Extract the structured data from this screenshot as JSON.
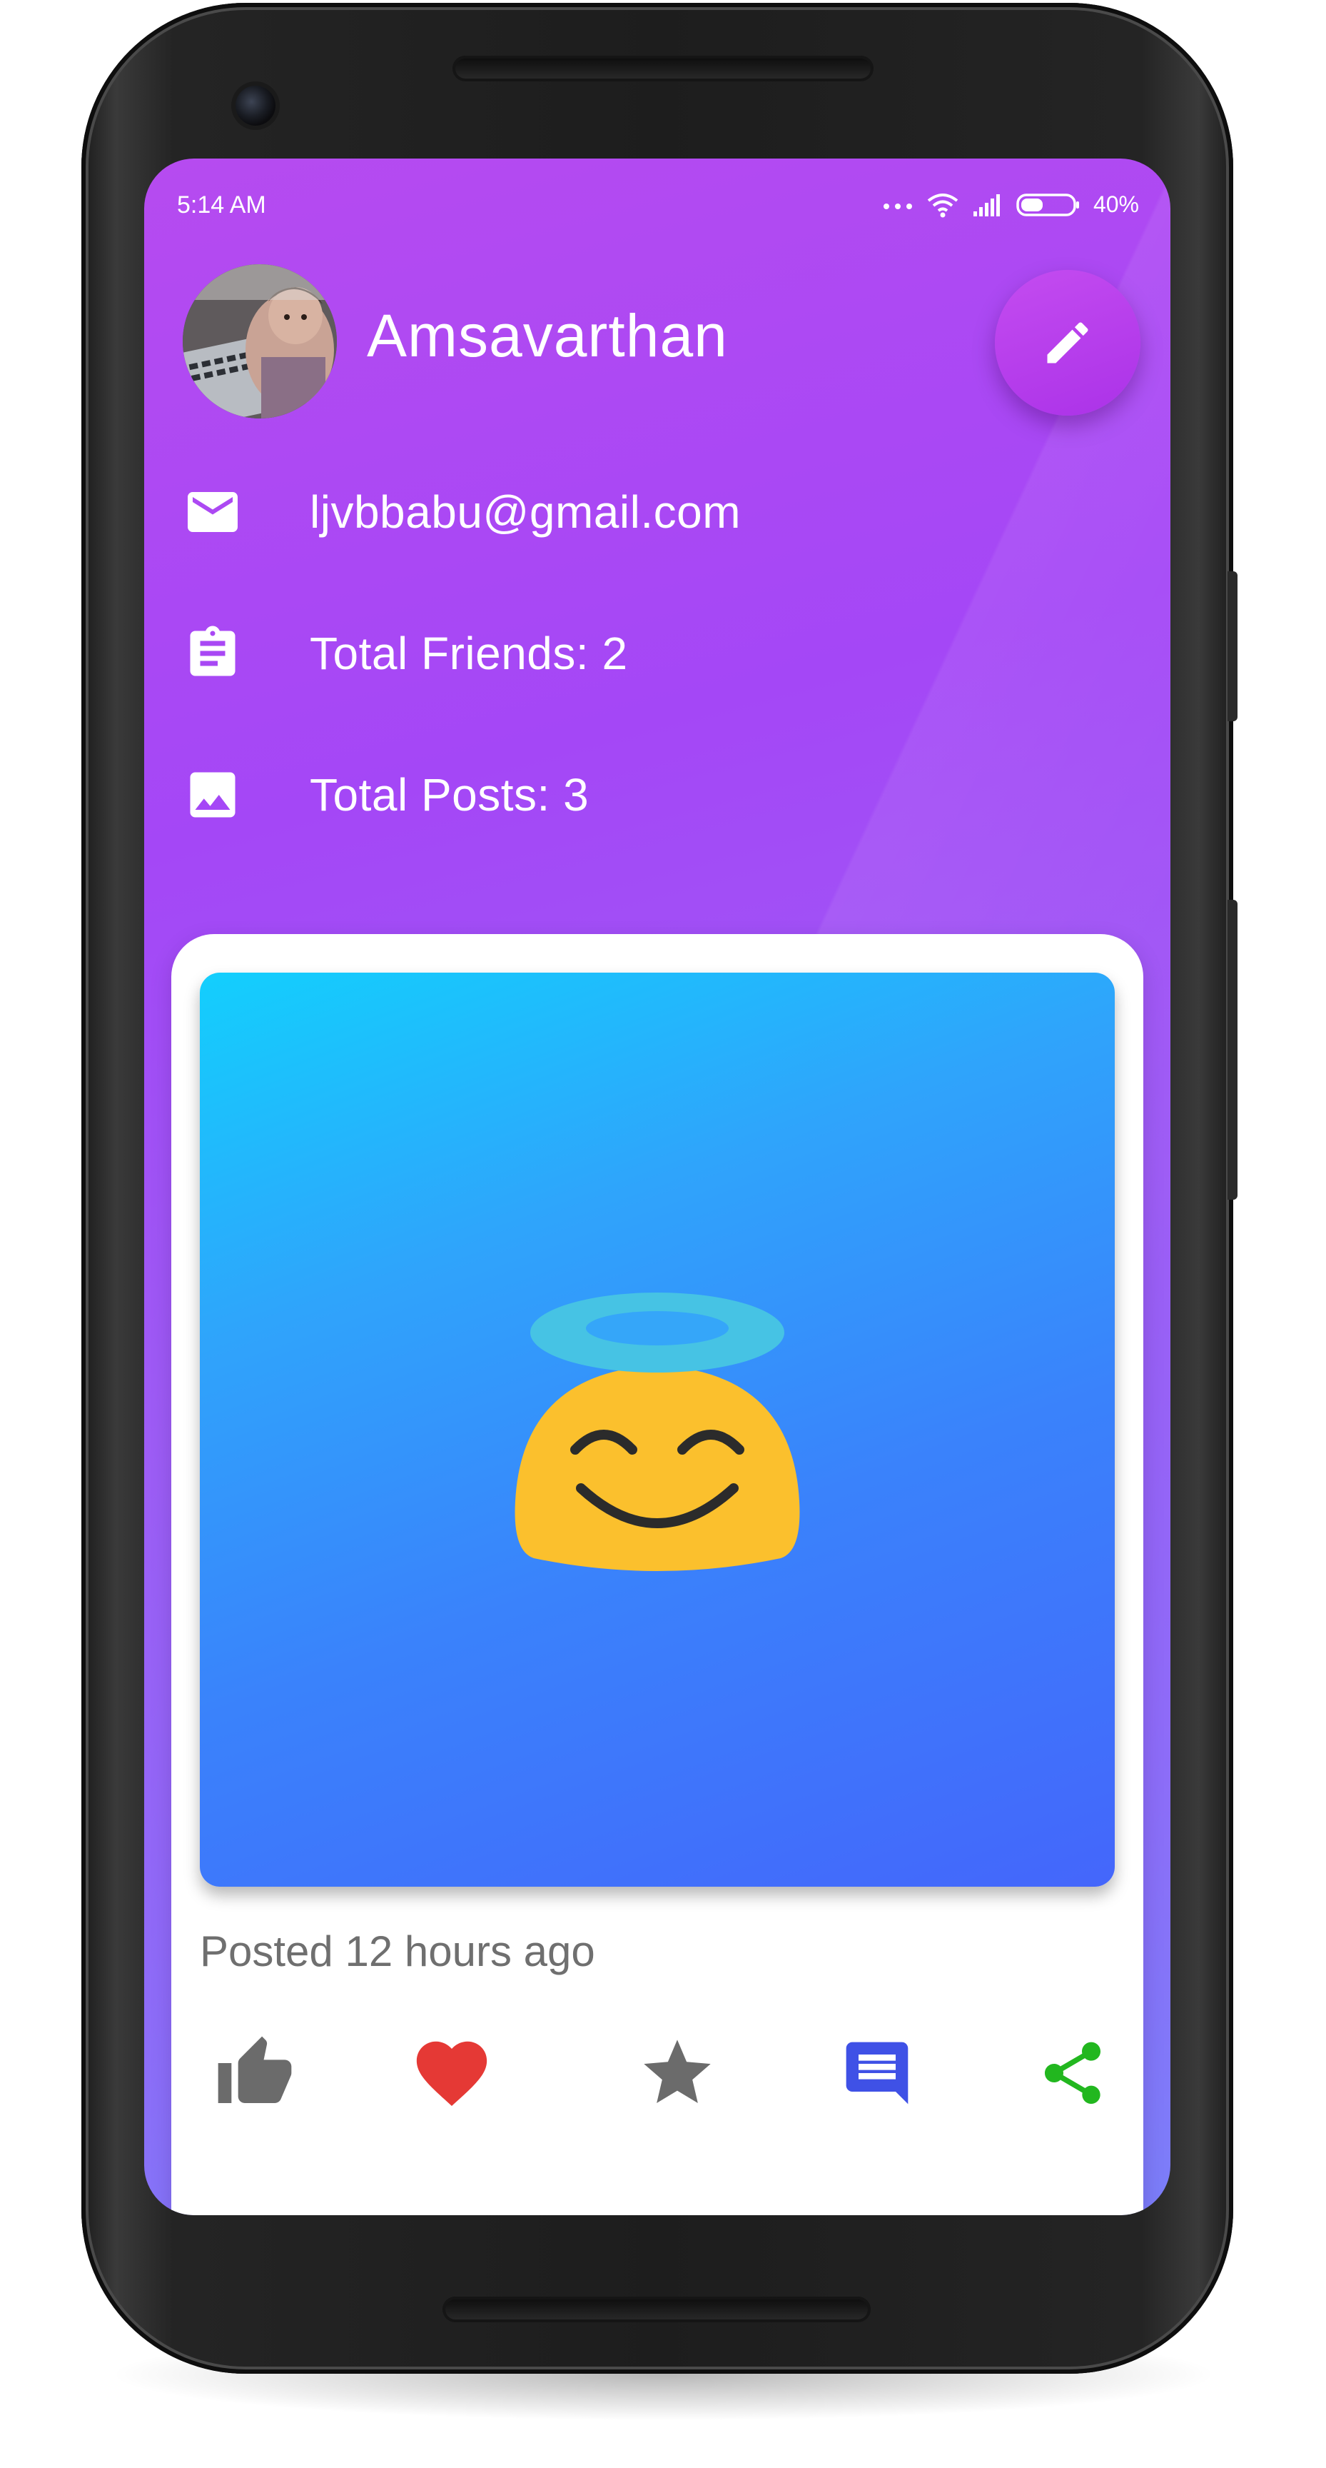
{
  "status_bar": {
    "time": "5:14 AM",
    "battery": "40%",
    "icons": [
      "more-dots-icon",
      "wifi-icon",
      "signal-icon",
      "battery-icon"
    ]
  },
  "profile": {
    "name": "Amsavarthan",
    "email": "ljvbbabu@gmail.com",
    "friends": "Total Friends: 2",
    "posts": "Total Posts: 3",
    "edit_icon": "pencil-icon",
    "email_icon": "mail-icon",
    "friends_icon": "clipboard-icon",
    "posts_icon": "image-icon"
  },
  "post": {
    "image_content": "smiling-face-with-halo-icon",
    "posted_time": "Posted 12 hours ago",
    "actions": [
      {
        "icon": "thumbs-up-icon",
        "color": "#6b6b6b"
      },
      {
        "icon": "heart-icon",
        "color": "#e53935"
      },
      {
        "icon": "star-icon",
        "color": "#6b6b6b"
      },
      {
        "icon": "comment-icon",
        "color": "#3f51e6"
      },
      {
        "icon": "share-icon",
        "color": "#22b71f"
      }
    ]
  },
  "colors": {
    "background_gradient_start": "#b64bf0",
    "background_gradient_end": "#7b7ef9",
    "fab": "#b03ee9",
    "image_gradient_start": "#13cffd",
    "image_gradient_end": "#4466fb"
  }
}
